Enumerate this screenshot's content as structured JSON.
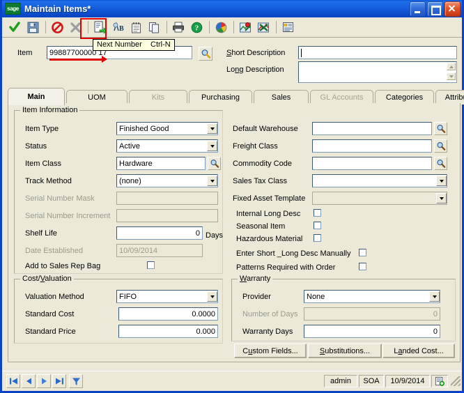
{
  "window": {
    "title": "Maintain Items*",
    "logo_text": "sage",
    "controls": {
      "minimize": "Minimize",
      "maximize": "Maximize",
      "close": "Close"
    }
  },
  "toolbar": {
    "items": [
      {
        "name": "ok-check-icon",
        "label": "OK"
      },
      {
        "name": "save-icon",
        "label": "Save"
      },
      {
        "name": "cancel-icon",
        "label": "Cancel"
      },
      {
        "name": "delete-x-icon",
        "label": "Delete"
      },
      {
        "name": "next-number-icon",
        "label": "Next Number"
      },
      {
        "name": "rename-ab-icon",
        "label": "Rename"
      },
      {
        "name": "notes-icon",
        "label": "Notes"
      },
      {
        "name": "copy-icon",
        "label": "Copy"
      },
      {
        "name": "print-icon",
        "label": "Print"
      },
      {
        "name": "help-icon",
        "label": "Help"
      },
      {
        "name": "globe-icon",
        "label": "Web"
      },
      {
        "name": "map-pin-red-icon",
        "label": "Map"
      },
      {
        "name": "map-pin-green-icon",
        "label": "Route"
      },
      {
        "name": "form-list-icon",
        "label": "Grid"
      }
    ]
  },
  "tooltip": {
    "text": "Next Number    Ctrl-N"
  },
  "header": {
    "item_label": "Item",
    "item_value": "99887700000 17",
    "short_description_label": "Short Description",
    "short_description_value": "",
    "long_description_label": "Long Description",
    "long_description_value": ""
  },
  "tabs": [
    {
      "label": "Main",
      "active": true,
      "disabled": false
    },
    {
      "label": "UOM",
      "active": false,
      "disabled": false
    },
    {
      "label": "Kits",
      "active": false,
      "disabled": true
    },
    {
      "label": "Purchasing",
      "active": false,
      "disabled": false
    },
    {
      "label": "Sales",
      "active": false,
      "disabled": false
    },
    {
      "label": "GL Accounts",
      "active": false,
      "disabled": true
    },
    {
      "label": "Categories",
      "active": false,
      "disabled": false
    },
    {
      "label": "Attributes",
      "active": false,
      "disabled": false
    }
  ],
  "item_information": {
    "title": "Item Information",
    "item_type_label": "Item Type",
    "item_type_value": "Finished Good",
    "status_label": "Status",
    "status_value": "Active",
    "item_class_label": "Item Class",
    "item_class_value": "Hardware",
    "track_method_label": "Track Method",
    "track_method_value": "(none)",
    "serial_number_mask_label": "Serial Number Mask",
    "serial_number_mask_value": "",
    "serial_number_increment_label": "Serial Number Increment",
    "serial_number_increment_value": "",
    "shelf_life_label": "Shelf Life",
    "shelf_life_value": "0",
    "shelf_life_units": "Days",
    "date_established_label": "Date Established",
    "date_established_value": "10/09/2014",
    "add_to_sales_rep_bag_label": "Add to Sales Rep Bag",
    "add_to_sales_rep_bag_checked": false
  },
  "item_details": {
    "default_warehouse_label": "Default Warehouse",
    "default_warehouse_value": "",
    "freight_class_label": "Freight Class",
    "freight_class_value": "",
    "commodity_code_label": "Commodity Code",
    "commodity_code_value": "",
    "sales_tax_class_label": "Sales Tax Class",
    "sales_tax_class_value": "",
    "fixed_asset_template_label": "Fixed Asset Template",
    "fixed_asset_template_value": "",
    "internal_long_desc_label": "Internal Long Desc",
    "internal_long_desc_checked": false,
    "seasonal_item_label": "Seasonal Item",
    "seasonal_item_checked": false,
    "hazardous_material_label": "Hazardous Material",
    "hazardous_material_checked": false,
    "enter_short_long_desc_label": "Enter Short _Long Desc Manually",
    "enter_short_long_desc_checked": false,
    "patterns_required_label": "Patterns Required with Order",
    "patterns_required_checked": false
  },
  "cost_valuation": {
    "title": "Cost/Valuation",
    "valuation_method_label": "Valuation Method",
    "valuation_method_value": "FIFO",
    "standard_cost_label": "Standard Cost",
    "standard_cost_value": "0.0000",
    "standard_price_label": "Standard Price",
    "standard_price_value": "0.000"
  },
  "warranty": {
    "title": "Warranty",
    "provider_label": "Provider",
    "provider_value": "None",
    "number_of_days_label": "Number of Days",
    "number_of_days_value": "0",
    "warranty_days_label": "Warranty Days",
    "warranty_days_value": "0"
  },
  "action_buttons": {
    "custom_fields": "Custom Fields...",
    "substitutions": "Substitutions...",
    "landed_cost": "Landed Cost..."
  },
  "statusbar": {
    "user": "admin",
    "company": "SOA",
    "date": "10/9/2014",
    "nav": {
      "first": "First record",
      "previous": "Previous record",
      "next": "Next record",
      "last": "Last record",
      "filter": "Filter"
    }
  },
  "colors": {
    "titlebar_blue": "#0a53d6",
    "form_bg": "#ece9d8",
    "field_border": "#7f9db9",
    "annotation_red": "#e00000",
    "disabled_text": "#9a9a8e"
  }
}
